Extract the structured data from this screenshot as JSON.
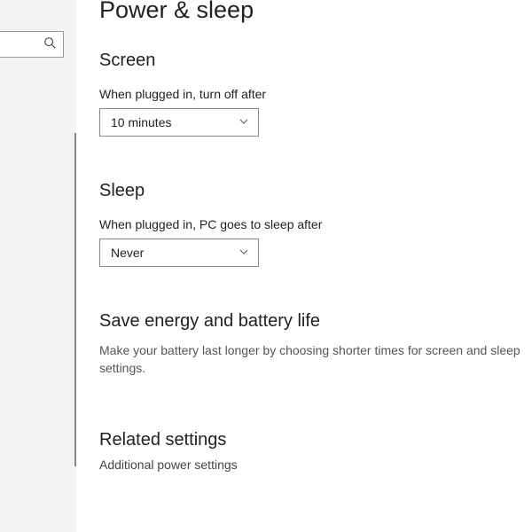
{
  "page": {
    "title": "Power & sleep"
  },
  "search": {
    "placeholder": ""
  },
  "screen": {
    "heading": "Screen",
    "plugged_label": "When plugged in, turn off after",
    "plugged_value": "10 minutes"
  },
  "sleep": {
    "heading": "Sleep",
    "plugged_label": "When plugged in, PC goes to sleep after",
    "plugged_value": "Never"
  },
  "energy": {
    "heading": "Save energy and battery life",
    "body": "Make your battery last longer by choosing shorter times for screen and sleep settings."
  },
  "related": {
    "heading": "Related settings",
    "link1": "Additional power settings"
  },
  "partial": {
    "heading": ""
  }
}
